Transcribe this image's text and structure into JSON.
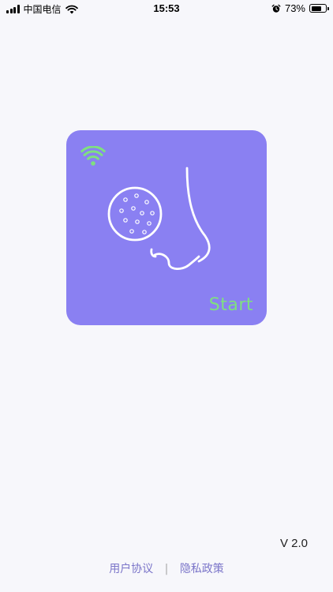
{
  "status_bar": {
    "carrier": "中国电信",
    "time": "15:53",
    "battery_percent": "73%",
    "battery_level": 0.73,
    "icons": [
      "signal-icon",
      "wifi-icon",
      "alarm-icon",
      "battery-icon"
    ]
  },
  "card": {
    "start_label": "Start",
    "background_color": "#8a80f2",
    "accent_color": "#7fe07f",
    "icons": [
      "wifi-icon",
      "magnifier-pores-icon",
      "nose-icon"
    ]
  },
  "version": "V 2.0",
  "footer": {
    "user_agreement": "用户协议",
    "separator": "|",
    "privacy_policy": "隐私政策",
    "link_color": "#7b75c9"
  }
}
